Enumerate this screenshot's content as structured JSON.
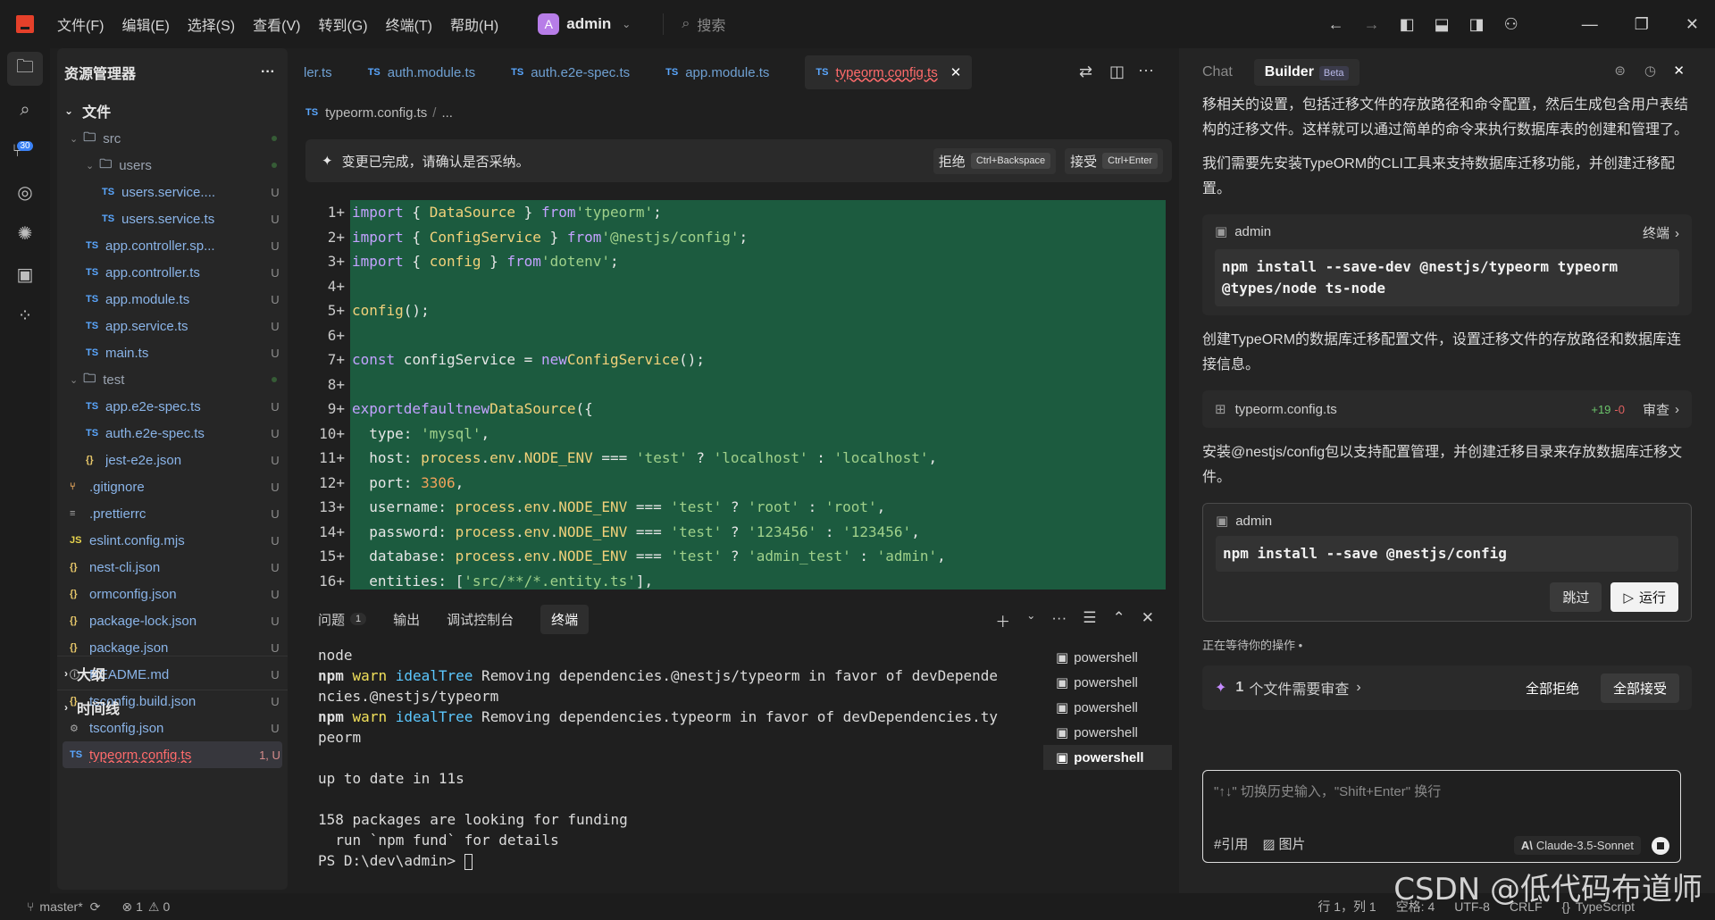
{
  "titlebar": {
    "menus": [
      "文件(F)",
      "编辑(E)",
      "选择(S)",
      "查看(V)",
      "转到(G)",
      "终端(T)",
      "帮助(H)"
    ],
    "avatar_letter": "A",
    "user": "admin",
    "search_placeholder": "搜索"
  },
  "activity": {
    "badge": "30"
  },
  "explorer": {
    "title": "资源管理器",
    "more": "···",
    "section_files": "文件",
    "items": [
      {
        "type": "folder",
        "name": "src",
        "depth": 0,
        "status": ""
      },
      {
        "type": "folder",
        "name": "users",
        "depth": 1,
        "status": ""
      },
      {
        "type": "ts",
        "icon": "TS",
        "name": "users.service....",
        "depth": 2,
        "status": "U"
      },
      {
        "type": "ts",
        "icon": "TS",
        "name": "users.service.ts",
        "depth": 2,
        "status": "U"
      },
      {
        "type": "ts",
        "icon": "TS",
        "name": "app.controller.sp...",
        "depth": 1,
        "status": "U"
      },
      {
        "type": "ts",
        "icon": "TS",
        "name": "app.controller.ts",
        "depth": 1,
        "status": "U"
      },
      {
        "type": "ts",
        "icon": "TS",
        "name": "app.module.ts",
        "depth": 1,
        "status": "U"
      },
      {
        "type": "ts",
        "icon": "TS",
        "name": "app.service.ts",
        "depth": 1,
        "status": "U"
      },
      {
        "type": "ts",
        "icon": "TS",
        "name": "main.ts",
        "depth": 1,
        "status": "U"
      },
      {
        "type": "folder",
        "name": "test",
        "depth": 0,
        "status": ""
      },
      {
        "type": "ts",
        "icon": "TS",
        "name": "app.e2e-spec.ts",
        "depth": 1,
        "status": "U"
      },
      {
        "type": "ts",
        "icon": "TS",
        "name": "auth.e2e-spec.ts",
        "depth": 1,
        "status": "U"
      },
      {
        "type": "json",
        "icon": "{}",
        "name": "jest-e2e.json",
        "depth": 1,
        "status": "U"
      },
      {
        "type": "git",
        "icon": "⑂",
        "name": ".gitignore",
        "depth": 0,
        "status": "U"
      },
      {
        "type": "cfg",
        "icon": "≡",
        "name": ".prettierrc",
        "depth": 0,
        "status": "U"
      },
      {
        "type": "js",
        "icon": "JS",
        "name": "eslint.config.mjs",
        "depth": 0,
        "status": "U"
      },
      {
        "type": "json",
        "icon": "{}",
        "name": "nest-cli.json",
        "depth": 0,
        "status": "U"
      },
      {
        "type": "json",
        "icon": "{}",
        "name": "ormconfig.json",
        "depth": 0,
        "status": "U"
      },
      {
        "type": "json",
        "icon": "{}",
        "name": "package-lock.json",
        "depth": 0,
        "status": "U"
      },
      {
        "type": "json",
        "icon": "{}",
        "name": "package.json",
        "depth": 0,
        "status": "U"
      },
      {
        "type": "md",
        "icon": "ⓘ",
        "name": "README.md",
        "depth": 0,
        "status": "U"
      },
      {
        "type": "json",
        "icon": "{}",
        "name": "tsconfig.build.json",
        "depth": 0,
        "status": "U"
      },
      {
        "type": "cfg",
        "icon": "⚙",
        "name": "tsconfig.json",
        "depth": 0,
        "status": "U"
      },
      {
        "type": "ts",
        "icon": "TS",
        "name": "typeorm.config.ts",
        "depth": 0,
        "status": "1, U",
        "selected": true
      }
    ],
    "section_outline": "大纲",
    "section_timeline": "时间线"
  },
  "editor": {
    "tabs": [
      {
        "icon": "",
        "label": "ler.ts"
      },
      {
        "icon": "TS",
        "label": "auth.module.ts"
      },
      {
        "icon": "TS",
        "label": "auth.e2e-spec.ts"
      },
      {
        "icon": "TS",
        "label": "app.module.ts"
      },
      {
        "icon": "TS",
        "label": "typeorm.config.ts",
        "active": true
      }
    ],
    "breadcrumb": "typeorm.config.ts",
    "breadcrumb_more": "...",
    "change_msg": "变更已完成，请确认是否采纳。",
    "reject": "拒绝",
    "reject_key": "Ctrl+Backspace",
    "accept": "接受",
    "accept_key": "Ctrl+Enter",
    "code": [
      "import { DataSource } from 'typeorm';",
      "import { ConfigService } from '@nestjs/config';",
      "import { config } from 'dotenv';",
      "",
      "config();",
      "",
      "const configService = new ConfigService();",
      "",
      "export default new DataSource({",
      "  type: 'mysql',",
      "  host: process.env.NODE_ENV === 'test' ? 'localhost' : 'localhost',",
      "  port: 3306,",
      "  username: process.env.NODE_ENV === 'test' ? 'root' : 'root',",
      "  password: process.env.NODE_ENV === 'test' ? '123456' : '123456',",
      "  database: process.env.NODE_ENV === 'test' ? 'admin_test' : 'admin',",
      "  entities: ['src/**/*.entity.ts'],"
    ]
  },
  "panel": {
    "tabs": [
      "问题",
      "输出",
      "调试控制台",
      "终端"
    ],
    "problem_count": "1",
    "terminal_lines": [
      "node",
      "npm warn idealTree Removing dependencies.@nestjs/typeorm in favor of devDepende",
      "ncies.@nestjs/typeorm",
      "npm warn idealTree Removing dependencies.typeorm in favor of devDependencies.ty",
      "peorm",
      "",
      "up to date in 11s",
      "",
      "158 packages are looking for funding",
      "  run `npm fund` for details",
      "PS D:\\dev\\admin> "
    ],
    "shells": [
      "powershell",
      "powershell",
      "powershell",
      "powershell",
      "powershell"
    ]
  },
  "chat": {
    "tab_chat": "Chat",
    "tab_builder": "Builder",
    "beta": "Beta",
    "p1": "移相关的设置，包括迁移文件的存放路径和命令配置，然后生成包含用户表结构的迁移文件。这样就可以通过简单的命令来执行数据库表的创建和管理了。",
    "p2": "我们需要先安装TypeORM的CLI工具来支持数据库迁移功能，并创建迁移配置。",
    "card1_user": "admin",
    "card1_link": "终端",
    "card1_cmd": "npm install --save-dev @nestjs/typeorm typeorm @types/node ts-node",
    "p3": "创建TypeORM的数据库迁移配置文件，设置迁移文件的存放路径和数据库连接信息。",
    "file_name": "typeorm.config.ts",
    "file_add": "+19",
    "file_del": "-0",
    "file_review": "审查",
    "p4": "安装@nestjs/config包以支持配置管理，并创建迁移目录来存放数据库迁移文件。",
    "card2_user": "admin",
    "card2_cmd": "npm install --save @nestjs/config",
    "skip": "跳过",
    "run": "运行",
    "waiting": "正在等待你的操作 •",
    "review_count": "1",
    "review_text": "个文件需要审查",
    "reject_all": "全部拒绝",
    "accept_all": "全部接受",
    "input_placeholder": "\"↑↓\" 切换历史输入，\"Shift+Enter\" 换行",
    "ref": "#引用",
    "image": "图片",
    "model": "Claude-3.5-Sonnet"
  },
  "status": {
    "branch": "master*",
    "errors": "1",
    "warnings": "0",
    "position": "行 1，列 1",
    "spaces": "空格: 4",
    "encoding": "UTF-8",
    "eol": "CRLF",
    "language": "TypeScript"
  },
  "watermark": "CSDN @低代码布道师"
}
